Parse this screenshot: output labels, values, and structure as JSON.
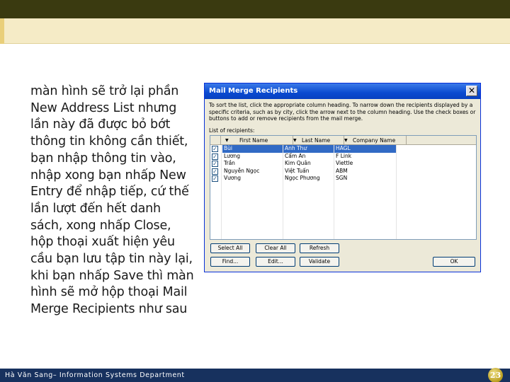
{
  "slide": {
    "body_text": "màn hình sẽ trở lại phần New Address List nhưng lần này đã được bỏ bớt thông tin không cần thiết, bạn nhập thông tin vào, nhập xong bạn nhấp New Entry để nhập tiếp, cứ thế lần lượt đến hết danh sách, xong nhấp Close, hộp thoại xuất hiện yêu cầu bạn lưu tập tin này lại, khi bạn nhấp Save thì màn hình sẽ mở hộp thoại Mail Merge Recipients như sau",
    "footer_text": "Hà Văn Sang– Information Systems Department",
    "page_number": "23"
  },
  "dialog": {
    "title": "Mail Merge Recipients",
    "close_glyph": "✕",
    "instructions": "To sort the list, click the appropriate column heading. To narrow down the recipients displayed by a specific criteria, such as by city, click the arrow next to the column heading. Use the check boxes or buttons to add or remove recipients from the mail merge.",
    "list_label": "List of recipients:",
    "columns": [
      "First Name",
      "Last Name",
      "Company Name"
    ],
    "sort_arrow": "▼",
    "rows": [
      {
        "checked": true,
        "first": "Bùi",
        "last": "Anh Thư",
        "company": "HAGL",
        "selected": true
      },
      {
        "checked": true,
        "first": "Lương",
        "last": "Cẩm An",
        "company": "F Link",
        "selected": false
      },
      {
        "checked": true,
        "first": "Trần",
        "last": "Kim Quân",
        "company": "Viettle",
        "selected": false
      },
      {
        "checked": true,
        "first": "Nguyễn Ngọc",
        "last": "Việt Tuấn",
        "company": "ABM",
        "selected": false
      },
      {
        "checked": true,
        "first": "Vương",
        "last": "Ngọc Phương",
        "company": "SGN",
        "selected": false
      }
    ],
    "check_glyph": "✓",
    "buttons": {
      "select_all": "Select All",
      "clear_all": "Clear All",
      "refresh": "Refresh",
      "find": "Find...",
      "edit": "Edit...",
      "validate": "Validate",
      "ok": "OK"
    }
  },
  "colors": {
    "top_bar": "#3a3a10",
    "footer": "#17315e",
    "title_bar": "#0a4ad0",
    "selection": "#316ac5"
  }
}
